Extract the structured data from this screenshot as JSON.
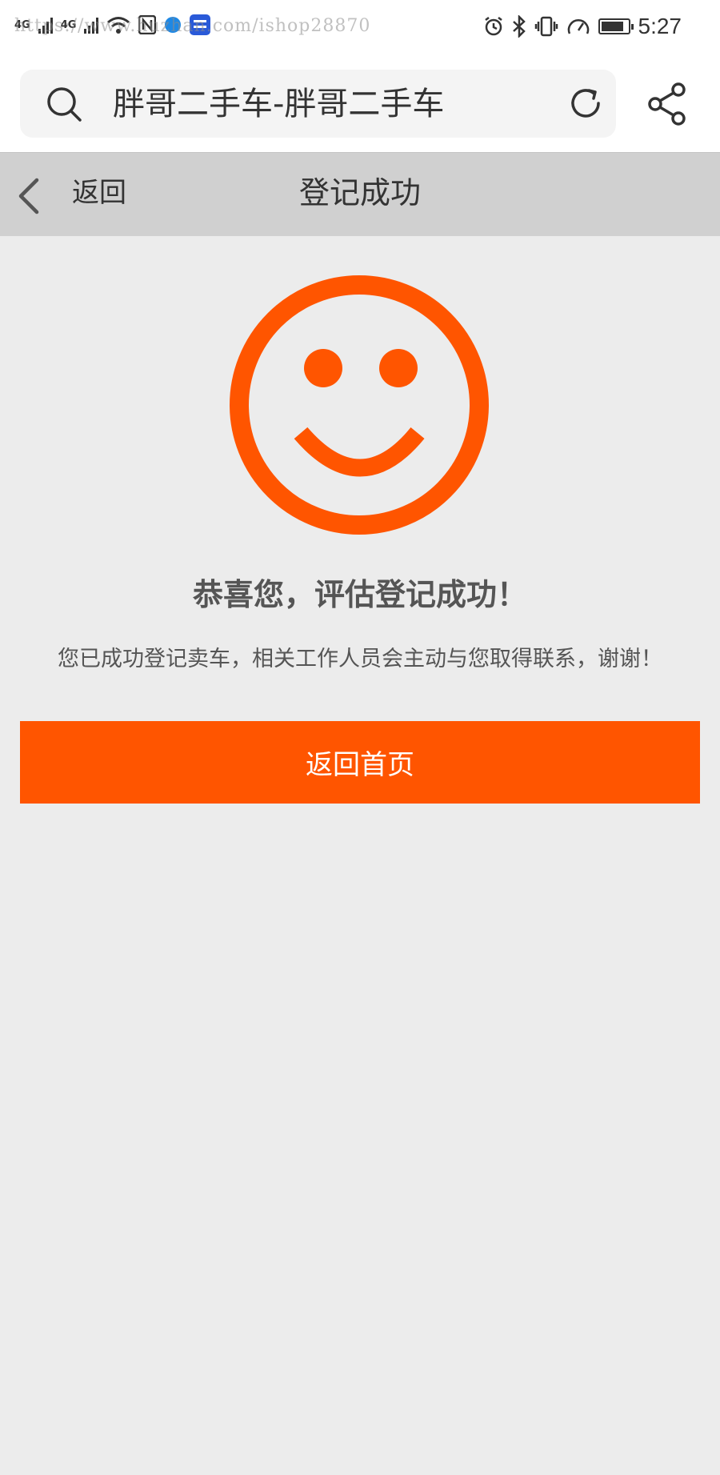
{
  "status_bar": {
    "network": [
      "4G",
      "4G"
    ],
    "watermark": "https://www.huzhan.com/ishop28870",
    "time": "5:27",
    "battery_level": 0.85
  },
  "browser": {
    "site_title": "胖哥二手车-胖哥二手车"
  },
  "nav": {
    "back_label": "返回",
    "title": "登记成功"
  },
  "result": {
    "headline": "恭喜您，评估登记成功！",
    "message": "您已成功登记卖车，相关工作人员会主动与您取得联系，谢谢！",
    "button_label": "返回首页"
  },
  "colors": {
    "accent": "#ff5500",
    "nav_bg": "#d0d0d0",
    "page_bg": "#ececec"
  },
  "icons": [
    "signal-icon",
    "wifi-icon",
    "nfc-icon",
    "alarm-icon",
    "bluetooth-icon",
    "vibrate-icon",
    "speed-icon",
    "battery-icon",
    "search-icon",
    "refresh-icon",
    "share-icon",
    "back-chevron-icon",
    "smiley-icon"
  ]
}
